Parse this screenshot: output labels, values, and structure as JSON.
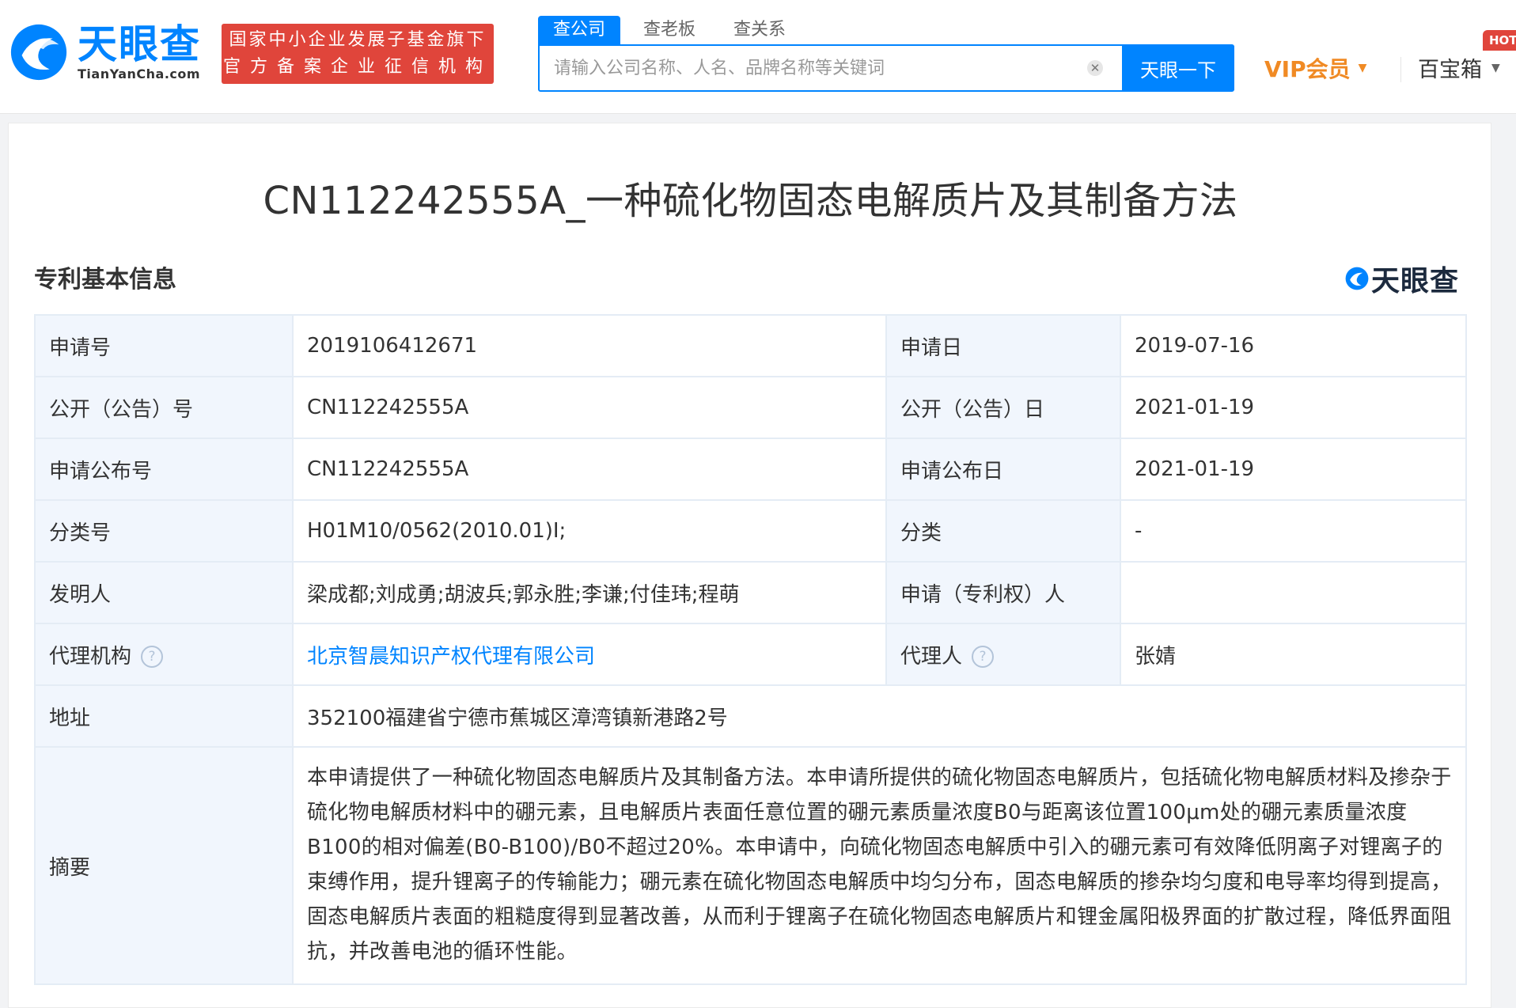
{
  "header": {
    "logo_cn": "天眼查",
    "logo_en": "TianYanCha.com",
    "gov_badge_line1": "国家中小企业发展子基金旗下",
    "gov_badge_line2": "官方备案企业征信机构",
    "search_tabs": [
      {
        "label": "查公司",
        "active": true
      },
      {
        "label": "查老板",
        "active": false
      },
      {
        "label": "查关系",
        "active": false
      }
    ],
    "search_placeholder": "请输入公司名称、人名、品牌名称等关键词",
    "search_button": "天眼一下",
    "vip_label": "VIP会员",
    "toolbox_label": "百宝箱",
    "hot_badge": "HOT"
  },
  "page": {
    "title": "CN112242555A_一种硫化物固态电解质片及其制备方法",
    "section_title": "专利基本信息",
    "watermark": "天眼查"
  },
  "patent": {
    "application_no_label": "申请号",
    "application_no": "2019106412671",
    "application_date_label": "申请日",
    "application_date": "2019-07-16",
    "publication_no_label": "公开（公告）号",
    "publication_no": "CN112242555A",
    "publication_date_label": "公开（公告）日",
    "publication_date": "2021-01-19",
    "announce_no_label": "申请公布号",
    "announce_no": "CN112242555A",
    "announce_date_label": "申请公布日",
    "announce_date": "2021-01-19",
    "class_no_label": "分类号",
    "class_no": "H01M10/0562(2010.01)I;",
    "category_label": "分类",
    "category": "-",
    "inventors_label": "发明人",
    "inventors": "梁成都;刘成勇;胡波兵;郭永胜;李谦;付佳玮;程萌",
    "applicant_label": "申请（专利权）人",
    "applicant": "",
    "agency_label": "代理机构",
    "agency": "北京智晨知识产权代理有限公司",
    "agent_label": "代理人",
    "agent": "张婧",
    "address_label": "地址",
    "address": "352100福建省宁德市蕉城区漳湾镇新港路2号",
    "abstract_label": "摘要",
    "abstract": "本申请提供了一种硫化物固态电解质片及其制备方法。本申请所提供的硫化物固态电解质片，包括硫化物电解质材料及掺杂于硫化物电解质材料中的硼元素，且电解质片表面任意位置的硼元素质量浓度B0与距离该位置100μm处的硼元素质量浓度B100的相对偏差(B0-B100)/B0不超过20%。本申请中，向硫化物固态电解质中引入的硼元素可有效降低阴离子对锂离子的束缚作用，提升锂离子的传输能力；硼元素在硫化物固态电解质中均匀分布，固态电解质的掺杂均匀度和电导率均得到提高，固态电解质片表面的粗糙度得到显著改善，从而利于锂离子在硫化物固态电解质片和锂金属阳极界面的扩散过程，降低界面阻抗，并改善电池的循环性能。"
  },
  "icons": {
    "help": "question-circle-icon",
    "clear": "close-circle-icon",
    "caret": "caret-down-icon"
  },
  "colors": {
    "brand_blue": "#0084ff",
    "badge_red": "#e0453b",
    "vip_orange": "#f08a24",
    "label_bg": "#f1f6fd"
  }
}
